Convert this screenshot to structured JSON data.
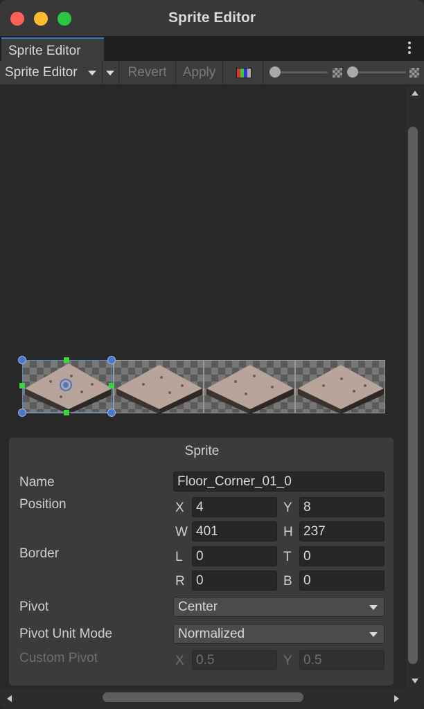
{
  "window": {
    "title": "Sprite Editor"
  },
  "tab": {
    "label": "Sprite Editor"
  },
  "toolbar": {
    "mode_label": "Sprite Editor",
    "revert_label": "Revert",
    "apply_label": "Apply"
  },
  "inspector": {
    "title": "Sprite",
    "name_label": "Name",
    "name_value": "Floor_Corner_01_0",
    "position_label": "Position",
    "position": {
      "x_label": "X",
      "x": "4",
      "y_label": "Y",
      "y": "8",
      "w_label": "W",
      "w": "401",
      "h_label": "H",
      "h": "237"
    },
    "border_label": "Border",
    "border": {
      "l_label": "L",
      "l": "0",
      "t_label": "T",
      "t": "0",
      "r_label": "R",
      "r": "0",
      "b_label": "B",
      "b": "0"
    },
    "pivot_label": "Pivot",
    "pivot_value": "Center",
    "pivot_unit_label": "Pivot Unit Mode",
    "pivot_unit_value": "Normalized",
    "custom_pivot_label": "Custom Pivot",
    "custom_pivot": {
      "x_label": "X",
      "x": "0.5",
      "y_label": "Y",
      "y": "0.5"
    }
  },
  "sprites": [
    {
      "selected": true
    },
    {
      "selected": false
    },
    {
      "selected": false
    },
    {
      "selected": false
    }
  ],
  "colors": {
    "accent": "#3a79bb",
    "selection": "#5a86d8",
    "handle_green": "#3ad63a",
    "tile_top": "#b8a49a"
  },
  "icons": [
    "close-window-icon",
    "minimize-window-icon",
    "maximize-window-icon",
    "kebab-menu-icon",
    "dropdown-arrow-icon",
    "color-channel-icon",
    "zoom-slider-icon",
    "alpha-checker-icon",
    "scroll-arrow-icon"
  ]
}
